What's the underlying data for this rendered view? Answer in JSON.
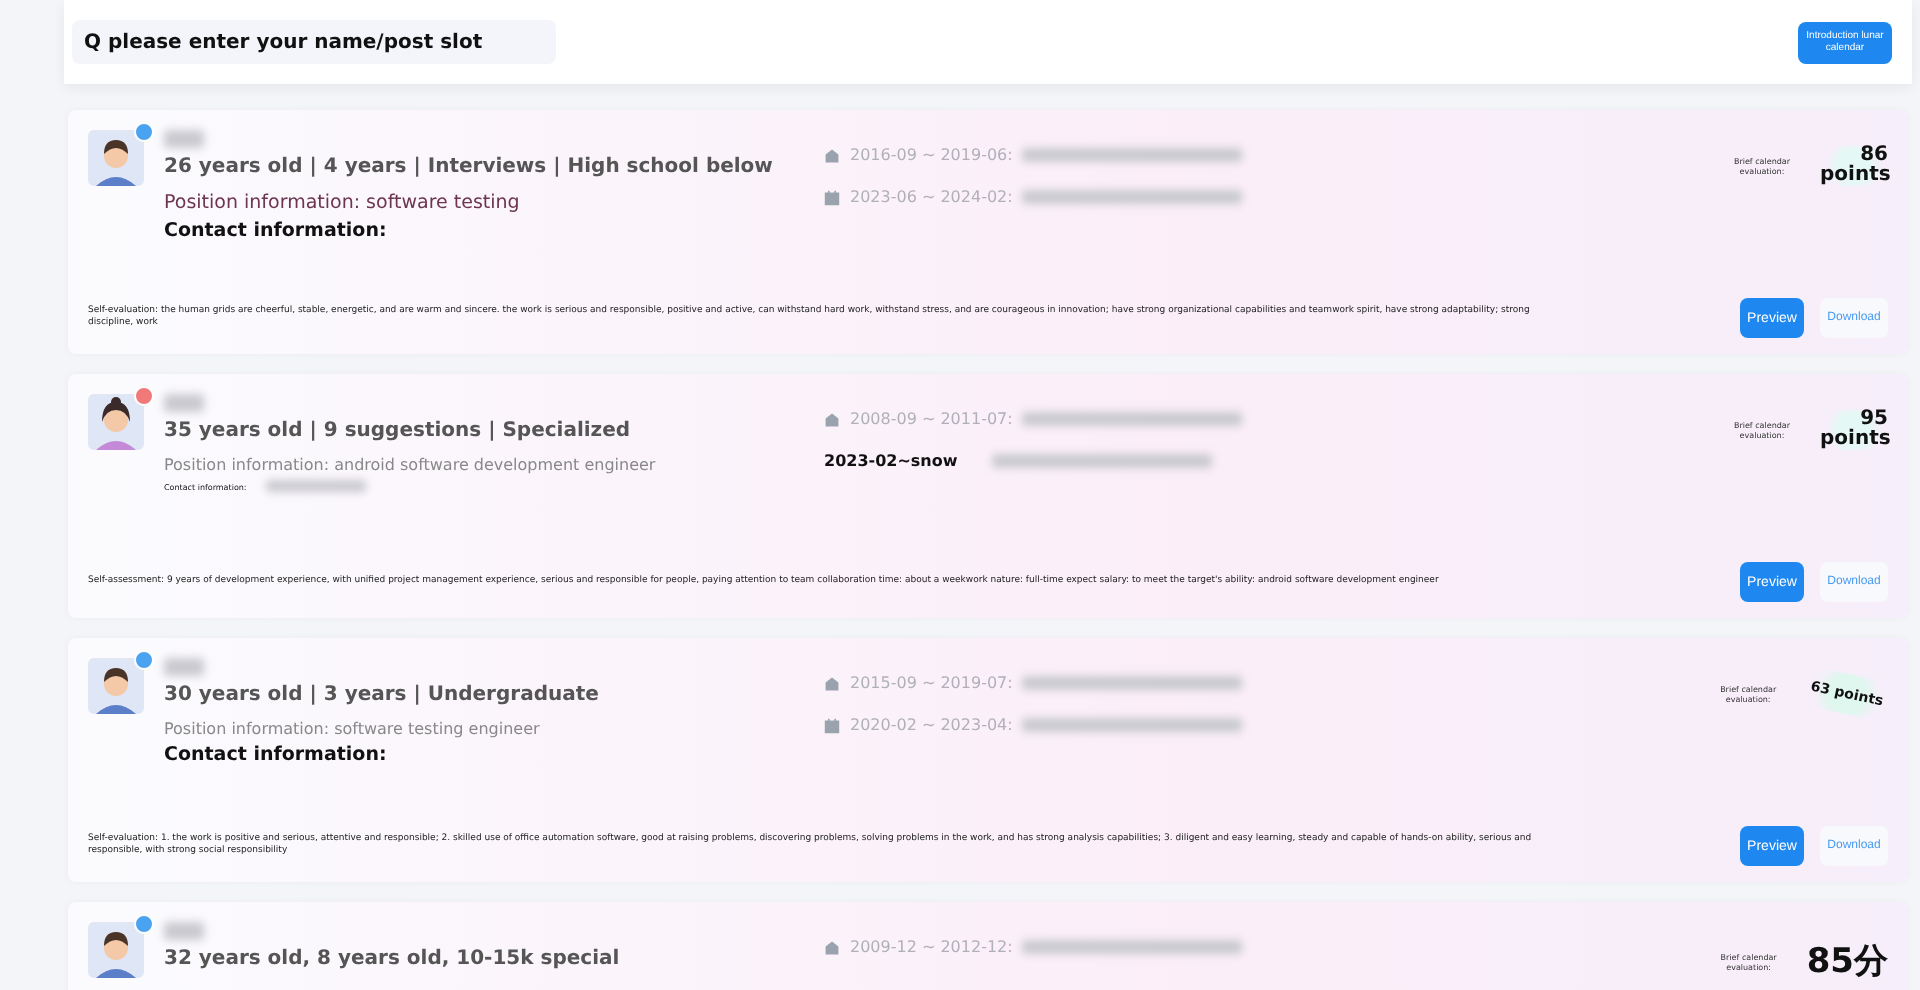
{
  "search": {
    "placeholder": "Q please enter your name/post slot"
  },
  "header_button": "Introduction lunar calendar",
  "candidates": [
    {
      "kind": "male",
      "color": "#4aa3f0",
      "summary": "26 years old | 4 years | Interviews | High school below",
      "position": {
        "text": "Position information: software testing",
        "kind": "accent"
      },
      "contact": {
        "label": "Contact information:",
        "kind": "bold"
      },
      "education": [
        {
          "kind": "dated",
          "period": "2016-09 ~ 2019-06:"
        },
        {
          "kind": "dated",
          "period": "2023-06 ~ 2024-02:"
        }
      ],
      "score": {
        "label": "Brief calendar evaluation:",
        "value": "86 points",
        "kind": "stacked"
      },
      "self_evaluation": "Self-evaluation: the human grids are cheerful, stable, energetic, and are warm and sincere. the work is serious and responsible, positive and active, can withstand hard work, withstand stress, and are courageous in innovation; have strong organizational capabilities and teamwork spirit, have strong adaptability; strong discipline, work",
      "buttons": [
        "Preview",
        "Download"
      ]
    },
    {
      "kind": "female",
      "color": "#f07a7a",
      "summary": "35 years old | 9 suggestions | Specialized",
      "position": {
        "text": "Position information: android software development engineer",
        "kind": "muted"
      },
      "contact": {
        "label": "Contact information:",
        "kind": "tiny"
      },
      "education": [
        {
          "kind": "dated",
          "period": "2008-09 ~ 2011-07:"
        },
        {
          "kind": "bold",
          "period": "2023-02~snow"
        }
      ],
      "score": {
        "label": "Brief calendar evaluation:",
        "value": "95 points",
        "kind": "stacked"
      },
      "self_evaluation": "Self-assessment: 9 years of development experience, with unified project management experience, serious and responsible for people, paying attention to team collaboration time: about a weekwork nature: full-time expect salary: to meet the target's ability: android software development engineer",
      "buttons": [
        "Preview",
        "Download"
      ]
    },
    {
      "kind": "male",
      "color": "#4aa3f0",
      "summary": "30 years old | 3 years | Undergraduate",
      "position": {
        "text": "Position information: software testing engineer",
        "kind": "muted"
      },
      "contact": {
        "label": "Contact information:",
        "kind": "bold"
      },
      "education": [
        {
          "kind": "dated",
          "period": "2015-09 ~ 2019-07:"
        },
        {
          "kind": "dated",
          "period": "2020-02 ~ 2023-04:"
        }
      ],
      "score": {
        "label": "Brief calendar evaluation:",
        "value": "63 points",
        "kind": "tilted"
      },
      "self_evaluation": "Self-evaluation: 1. the work is positive and serious, attentive and responsible; 2. skilled use of office automation software, good at raising problems, discovering problems, solving problems in the work, and has strong analysis capabilities; 3. diligent and easy learning, steady and capable of hands-on ability, serious and responsible, with strong social responsibility",
      "buttons": [
        "Preview",
        "Download"
      ]
    },
    {
      "kind": "male",
      "color": "#4aa3f0",
      "summary": "32 years old, 8 years old, 10-15k special",
      "education": [
        {
          "kind": "dated",
          "period": "2009-12 ~ 2012-12:"
        }
      ],
      "score": {
        "label": "Brief calendar evaluation:",
        "value": "85分",
        "kind": "large"
      }
    }
  ]
}
